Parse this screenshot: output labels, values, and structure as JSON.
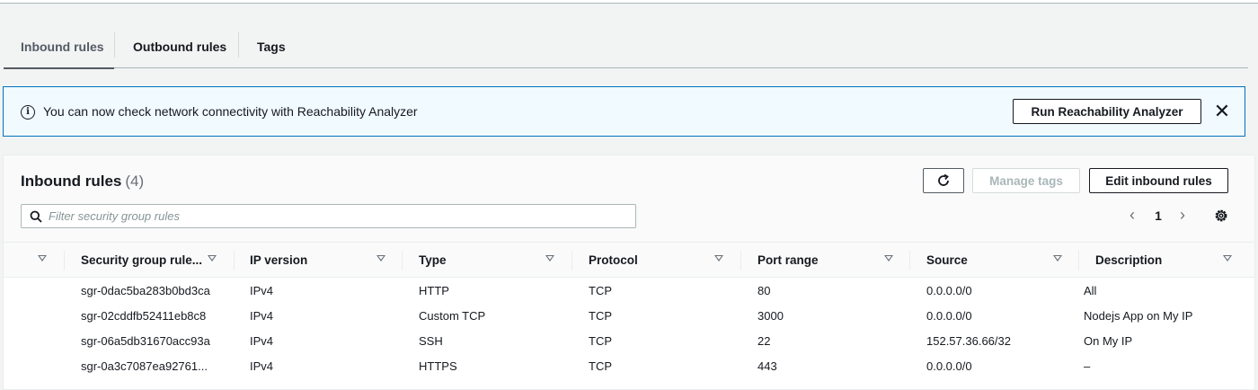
{
  "tabs": [
    {
      "label": "Inbound rules",
      "active": true
    },
    {
      "label": "Outbound rules",
      "active": false
    },
    {
      "label": "Tags",
      "active": false
    }
  ],
  "banner": {
    "icon": "info-icon",
    "text": "You can now check network connectivity with Reachability Analyzer",
    "action_label": "Run Reachability Analyzer",
    "close_icon": "close-icon"
  },
  "rules_panel": {
    "title": "Inbound rules",
    "count": "(4)",
    "refresh_icon": "refresh-icon",
    "manage_tags_label": "Manage tags",
    "edit_label": "Edit inbound rules",
    "filter_placeholder": "Filter security group rules",
    "page": "1",
    "columns": [
      "Security group rule...",
      "IP version",
      "Type",
      "Protocol",
      "Port range",
      "Source",
      "Description"
    ],
    "rows": [
      [
        "sgr-0dac5ba283b0bd3ca",
        "IPv4",
        "HTTP",
        "TCP",
        "80",
        "0.0.0.0/0",
        "All"
      ],
      [
        "sgr-02cddfb52411eb8c8",
        "IPv4",
        "Custom TCP",
        "TCP",
        "3000",
        "0.0.0.0/0",
        "Nodejs App on My IP"
      ],
      [
        "sgr-06a5db31670acc93a",
        "IPv4",
        "SSH",
        "TCP",
        "22",
        "152.57.36.66/32",
        "On My IP"
      ],
      [
        "sgr-0a3c7087ea92761...",
        "IPv4",
        "HTTPS",
        "TCP",
        "443",
        "0.0.0.0/0",
        "–"
      ]
    ]
  },
  "colors": {
    "accent": "#0073bb",
    "banner_bg": "#f1faff",
    "text": "#16191f"
  }
}
